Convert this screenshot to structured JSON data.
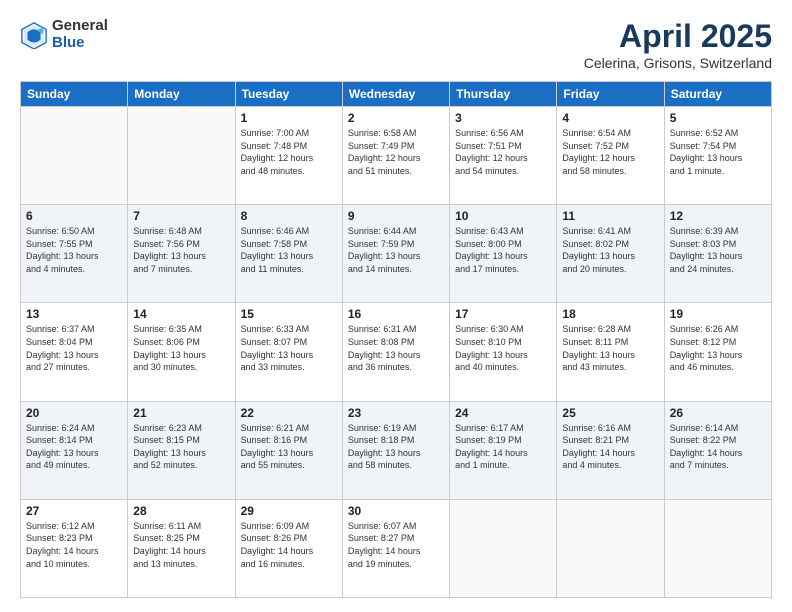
{
  "header": {
    "logo_general": "General",
    "logo_blue": "Blue",
    "title": "April 2025",
    "subtitle": "Celerina, Grisons, Switzerland"
  },
  "days_of_week": [
    "Sunday",
    "Monday",
    "Tuesday",
    "Wednesday",
    "Thursday",
    "Friday",
    "Saturday"
  ],
  "weeks": [
    [
      {
        "day": "",
        "info": ""
      },
      {
        "day": "",
        "info": ""
      },
      {
        "day": "1",
        "info": "Sunrise: 7:00 AM\nSunset: 7:48 PM\nDaylight: 12 hours\nand 48 minutes."
      },
      {
        "day": "2",
        "info": "Sunrise: 6:58 AM\nSunset: 7:49 PM\nDaylight: 12 hours\nand 51 minutes."
      },
      {
        "day": "3",
        "info": "Sunrise: 6:56 AM\nSunset: 7:51 PM\nDaylight: 12 hours\nand 54 minutes."
      },
      {
        "day": "4",
        "info": "Sunrise: 6:54 AM\nSunset: 7:52 PM\nDaylight: 12 hours\nand 58 minutes."
      },
      {
        "day": "5",
        "info": "Sunrise: 6:52 AM\nSunset: 7:54 PM\nDaylight: 13 hours\nand 1 minute."
      }
    ],
    [
      {
        "day": "6",
        "info": "Sunrise: 6:50 AM\nSunset: 7:55 PM\nDaylight: 13 hours\nand 4 minutes."
      },
      {
        "day": "7",
        "info": "Sunrise: 6:48 AM\nSunset: 7:56 PM\nDaylight: 13 hours\nand 7 minutes."
      },
      {
        "day": "8",
        "info": "Sunrise: 6:46 AM\nSunset: 7:58 PM\nDaylight: 13 hours\nand 11 minutes."
      },
      {
        "day": "9",
        "info": "Sunrise: 6:44 AM\nSunset: 7:59 PM\nDaylight: 13 hours\nand 14 minutes."
      },
      {
        "day": "10",
        "info": "Sunrise: 6:43 AM\nSunset: 8:00 PM\nDaylight: 13 hours\nand 17 minutes."
      },
      {
        "day": "11",
        "info": "Sunrise: 6:41 AM\nSunset: 8:02 PM\nDaylight: 13 hours\nand 20 minutes."
      },
      {
        "day": "12",
        "info": "Sunrise: 6:39 AM\nSunset: 8:03 PM\nDaylight: 13 hours\nand 24 minutes."
      }
    ],
    [
      {
        "day": "13",
        "info": "Sunrise: 6:37 AM\nSunset: 8:04 PM\nDaylight: 13 hours\nand 27 minutes."
      },
      {
        "day": "14",
        "info": "Sunrise: 6:35 AM\nSunset: 8:06 PM\nDaylight: 13 hours\nand 30 minutes."
      },
      {
        "day": "15",
        "info": "Sunrise: 6:33 AM\nSunset: 8:07 PM\nDaylight: 13 hours\nand 33 minutes."
      },
      {
        "day": "16",
        "info": "Sunrise: 6:31 AM\nSunset: 8:08 PM\nDaylight: 13 hours\nand 36 minutes."
      },
      {
        "day": "17",
        "info": "Sunrise: 6:30 AM\nSunset: 8:10 PM\nDaylight: 13 hours\nand 40 minutes."
      },
      {
        "day": "18",
        "info": "Sunrise: 6:28 AM\nSunset: 8:11 PM\nDaylight: 13 hours\nand 43 minutes."
      },
      {
        "day": "19",
        "info": "Sunrise: 6:26 AM\nSunset: 8:12 PM\nDaylight: 13 hours\nand 46 minutes."
      }
    ],
    [
      {
        "day": "20",
        "info": "Sunrise: 6:24 AM\nSunset: 8:14 PM\nDaylight: 13 hours\nand 49 minutes."
      },
      {
        "day": "21",
        "info": "Sunrise: 6:23 AM\nSunset: 8:15 PM\nDaylight: 13 hours\nand 52 minutes."
      },
      {
        "day": "22",
        "info": "Sunrise: 6:21 AM\nSunset: 8:16 PM\nDaylight: 13 hours\nand 55 minutes."
      },
      {
        "day": "23",
        "info": "Sunrise: 6:19 AM\nSunset: 8:18 PM\nDaylight: 13 hours\nand 58 minutes."
      },
      {
        "day": "24",
        "info": "Sunrise: 6:17 AM\nSunset: 8:19 PM\nDaylight: 14 hours\nand 1 minute."
      },
      {
        "day": "25",
        "info": "Sunrise: 6:16 AM\nSunset: 8:21 PM\nDaylight: 14 hours\nand 4 minutes."
      },
      {
        "day": "26",
        "info": "Sunrise: 6:14 AM\nSunset: 8:22 PM\nDaylight: 14 hours\nand 7 minutes."
      }
    ],
    [
      {
        "day": "27",
        "info": "Sunrise: 6:12 AM\nSunset: 8:23 PM\nDaylight: 14 hours\nand 10 minutes."
      },
      {
        "day": "28",
        "info": "Sunrise: 6:11 AM\nSunset: 8:25 PM\nDaylight: 14 hours\nand 13 minutes."
      },
      {
        "day": "29",
        "info": "Sunrise: 6:09 AM\nSunset: 8:26 PM\nDaylight: 14 hours\nand 16 minutes."
      },
      {
        "day": "30",
        "info": "Sunrise: 6:07 AM\nSunset: 8:27 PM\nDaylight: 14 hours\nand 19 minutes."
      },
      {
        "day": "",
        "info": ""
      },
      {
        "day": "",
        "info": ""
      },
      {
        "day": "",
        "info": ""
      }
    ]
  ]
}
